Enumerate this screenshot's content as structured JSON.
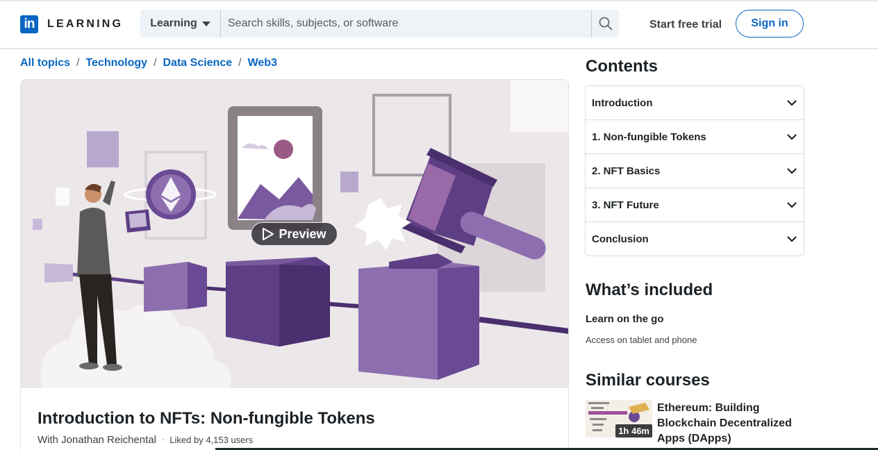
{
  "header": {
    "logo_mark": "in",
    "logo_text": "LEARNING",
    "search_scope": "Learning",
    "search_placeholder": "Search skills, subjects, or software",
    "start_trial": "Start free trial",
    "sign_in": "Sign in"
  },
  "breadcrumb": [
    "All topics",
    "Technology",
    "Data Science",
    "Web3"
  ],
  "breadcrumb_separator": "/",
  "hero": {
    "preview_label": "Preview",
    "title": "Introduction to NFTs: Non-fungible Tokens",
    "author": "With Jonathan Reichental",
    "dot": "·",
    "likes": "Liked by 4,153 users"
  },
  "contents": {
    "heading": "Contents",
    "chapters": [
      "Introduction",
      "1. Non-fungible Tokens",
      "2. NFT Basics",
      "3. NFT Future",
      "Conclusion"
    ]
  },
  "included": {
    "heading": "What’s included",
    "item_title": "Learn on the go",
    "item_sub": "Access on tablet and phone"
  },
  "similar": {
    "heading": "Similar courses",
    "items": [
      {
        "title": "Ethereum: Building Blockchain Decentralized Apps (DApps)",
        "duration": "1h 46m"
      }
    ]
  },
  "colors": {
    "brand": "#0a66c2",
    "illustration_purple": "#5e3f86",
    "illustration_light_purple": "#8d6fb0"
  },
  "icons": [
    "linkedin-logo-icon",
    "chevron-down-icon",
    "search-icon",
    "play-icon"
  ]
}
